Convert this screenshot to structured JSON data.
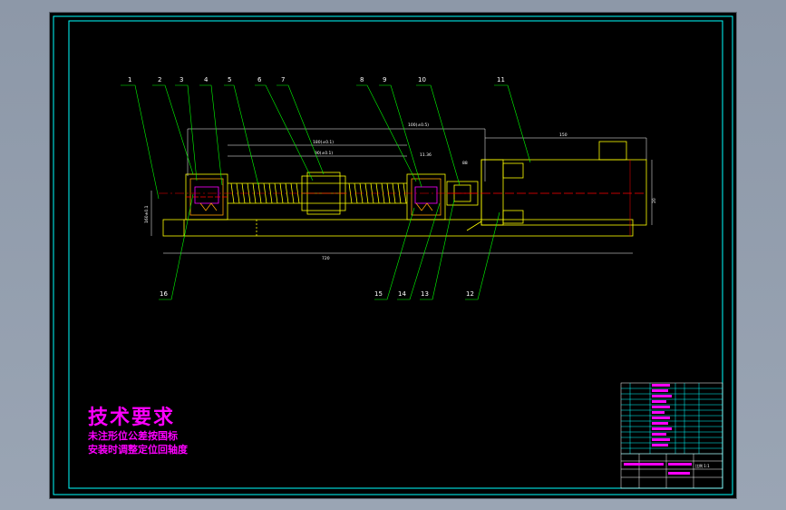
{
  "technical_requirements": {
    "title": "技术要求",
    "lines": [
      "未注形位公差按国标",
      "安装时调整定位回轴度"
    ]
  },
  "part_labels": [
    "1",
    "2",
    "3",
    "4",
    "5",
    "6",
    "7",
    "8",
    "9",
    "10",
    "11",
    "16",
    "15",
    "14",
    "13",
    "12"
  ],
  "dimensions": [
    "100(±0.5)",
    "150",
    "180(±0.1)",
    "90(±0.1)",
    "88",
    "11.36",
    "160±0.1",
    "720",
    "20"
  ],
  "title_block": {
    "scale": "比例 1:1"
  },
  "colors": {
    "background": "#000000",
    "frame": "#00ffff",
    "part_outline": "#ffff00",
    "leader": "#00ff00",
    "centerline": "#ff0000",
    "text": "#ff00ff",
    "label": "#ffffff"
  }
}
